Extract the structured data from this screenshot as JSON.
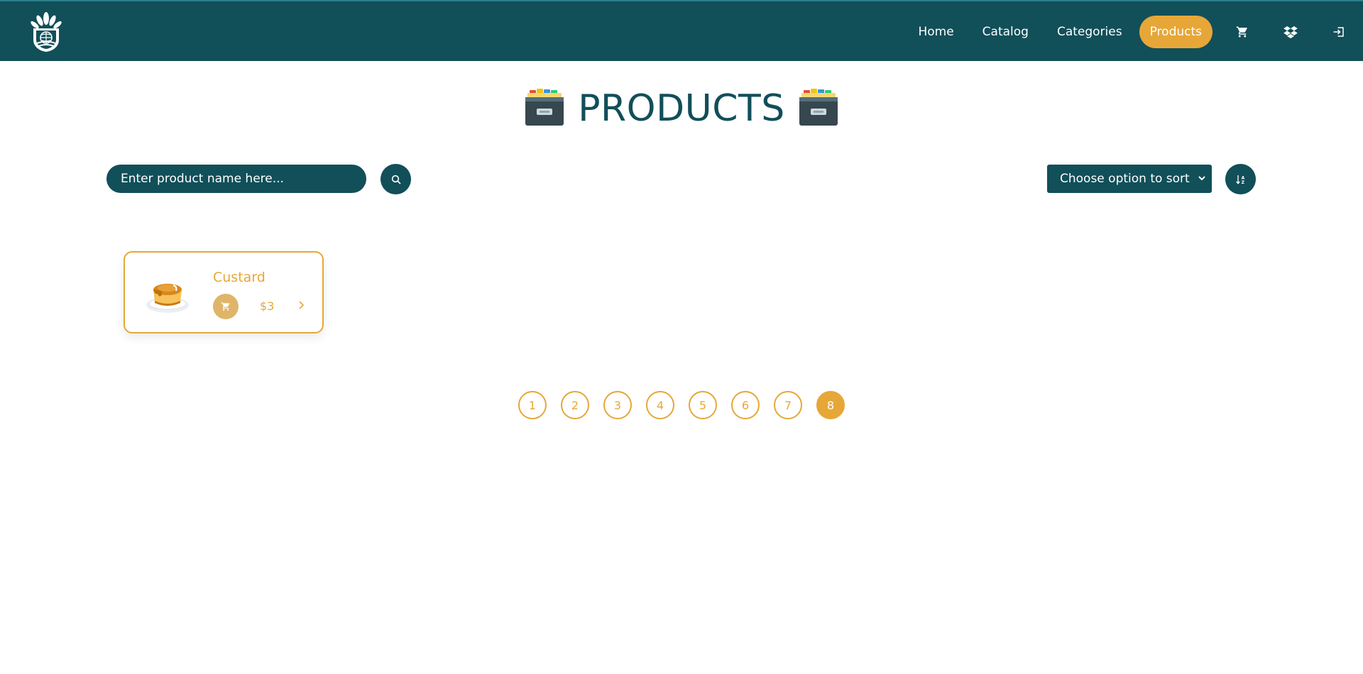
{
  "nav": {
    "logo_icon": "lotus-globe-logo",
    "links": [
      "Home",
      "Catalog",
      "Categories"
    ],
    "active_link": "Products",
    "icons": [
      "cart-icon",
      "dropbox-icon",
      "logout-icon"
    ]
  },
  "page": {
    "title": "PRODUCTS",
    "title_icon": "card-file-box-emoji"
  },
  "search": {
    "placeholder": "Enter product name here..."
  },
  "sort": {
    "selected": "Choose option to sort"
  },
  "products": [
    {
      "name": "Custard",
      "price": "$3",
      "image_icon": "custard-pudding-emoji"
    }
  ],
  "pagination": {
    "pages": [
      "1",
      "2",
      "3",
      "4",
      "5",
      "6",
      "7",
      "8"
    ],
    "current": "8"
  },
  "colors": {
    "primary": "#114f59",
    "accent": "#e6a738",
    "cart_button": "#dfb56a"
  }
}
